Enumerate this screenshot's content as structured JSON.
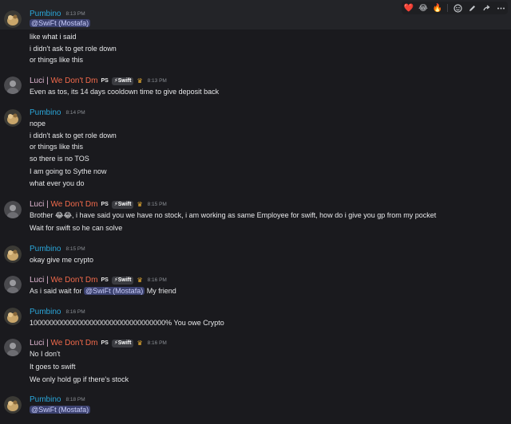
{
  "messages": [
    {
      "user": "Pumbino",
      "time": "8:13 PM",
      "mention": "@SwiFt (Mostafa)",
      "lines": [
        "like what i said",
        "i didn't ask to get role down",
        "or things like this"
      ]
    },
    {
      "user": "Luci | We Don't Dm",
      "ps": "PS",
      "tag": "⚡Swift",
      "time": "8:13 PM",
      "lines": [
        "Even as tos, its 14 days cooldown time to give deposit back"
      ]
    },
    {
      "user": "Pumbino",
      "time": "8:14 PM",
      "lines": [
        "nope",
        "i didn't ask to get role down",
        "or things like this",
        "so there is no TOS",
        "I  am going to Sythe now",
        "what ever you do"
      ]
    },
    {
      "user": "Luci | We Don't Dm",
      "ps": "PS",
      "tag": "⚡Swift",
      "time": "8:15 PM",
      "lines": [
        "Brother 😂😂, i have said you we have no stock, i am working as same Employee for swift, how do i give you gp from my pocket",
        "Wait for swift so he can solve"
      ]
    },
    {
      "user": "Pumbino",
      "time": "8:15 PM",
      "lines": [
        "okay give me crypto"
      ]
    },
    {
      "user": "Luci | We Don't Dm",
      "ps": "PS",
      "tag": "⚡Swift",
      "time": "8:16 PM",
      "line_pre": "As i said wait for",
      "mention": "@SwiFt (Mostafa)",
      "line_post": "My friend"
    },
    {
      "user": "Pumbino",
      "time": "8:16 PM",
      "lines": [
        "1000000000000000000000000000000000% You owe Crypto"
      ]
    },
    {
      "user": "Luci | We Don't Dm",
      "ps": "PS",
      "tag": "⚡Swift",
      "time": "8:16 PM",
      "lines": [
        "No I don't",
        "It goes to swift",
        "We only hold gp if there's stock"
      ]
    },
    {
      "user": "Pumbino",
      "time": "8:18 PM",
      "mention": "@SwiFt (Mostafa)"
    }
  ],
  "luci_name_main": "Luci | ",
  "luci_name_sub": "We Don't Dm",
  "toolbar": {
    "reactions": [
      "❤️",
      "😂",
      "🔥"
    ]
  },
  "colors": {
    "pumbino": "#2aa6d9",
    "luci": "#e0b6d1",
    "luci_sub": "#f26a4b",
    "mention_bg": "#3c4270"
  }
}
